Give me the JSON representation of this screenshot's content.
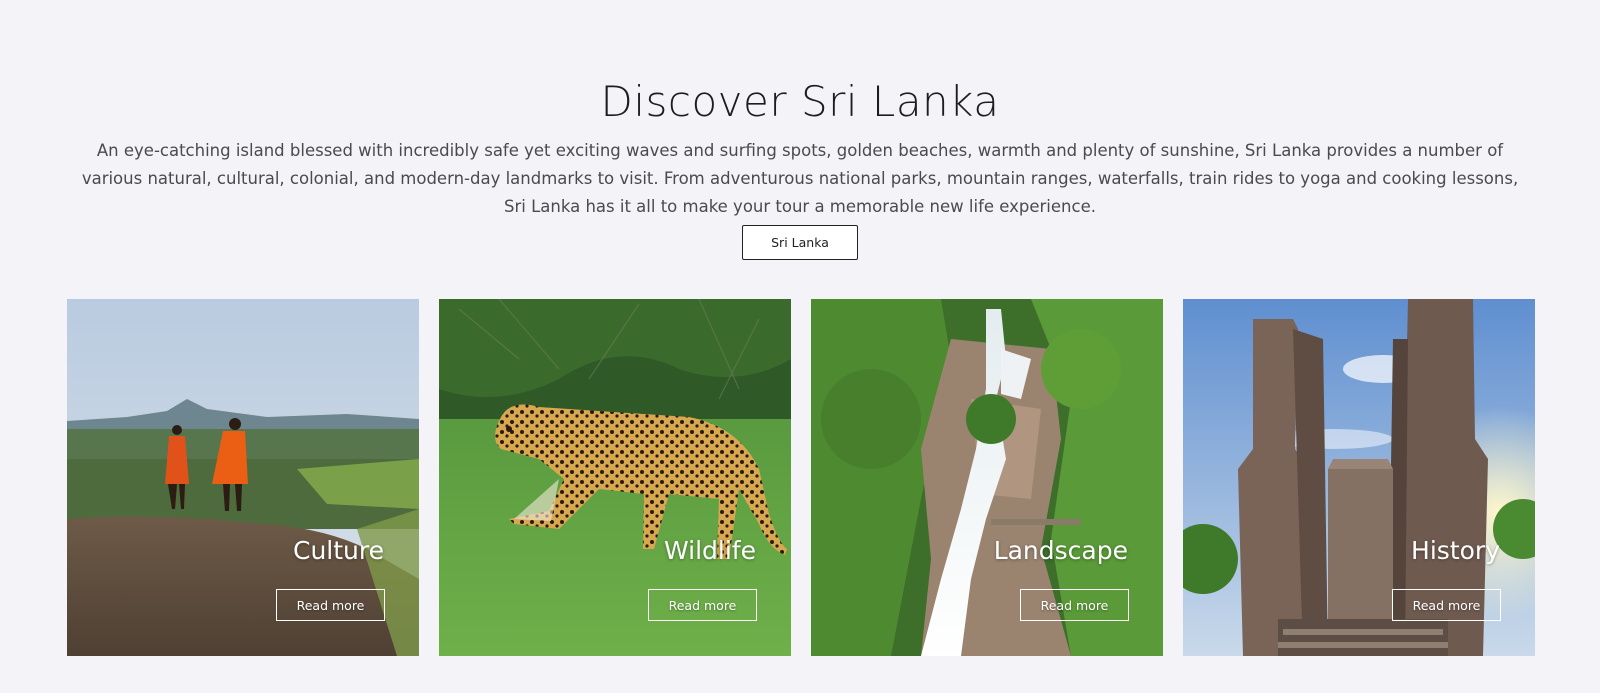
{
  "header": {
    "title": "Discover Sri Lanka",
    "description": "An eye-catching island blessed with incredibly safe yet exciting waves and surfing spots, golden beaches, warmth and plenty of sunshine, Sri Lanka provides a number of various natural, cultural, colonial, and modern-day landmarks to visit. From adventurous national parks, mountain ranges, waterfalls, train rides to yoga and cooking lessons, Sri Lanka has it all to make your tour a memorable new life experience.",
    "button_label": "Sri Lanka"
  },
  "cards": [
    {
      "title": "Culture",
      "button_label": "Read more",
      "image": "monks-on-rock-photo"
    },
    {
      "title": "Wildlife",
      "button_label": "Read more",
      "image": "leopard-photo"
    },
    {
      "title": "Landscape",
      "button_label": "Read more",
      "image": "waterfall-photo"
    },
    {
      "title": "History",
      "button_label": "Read more",
      "image": "ancient-ruins-photo"
    }
  ],
  "colors": {
    "page_background": "#f4f3f8",
    "heading_text": "#1d1d1f",
    "body_text": "#4a4a4f",
    "button_border": "#222222",
    "card_text": "#ffffff"
  }
}
